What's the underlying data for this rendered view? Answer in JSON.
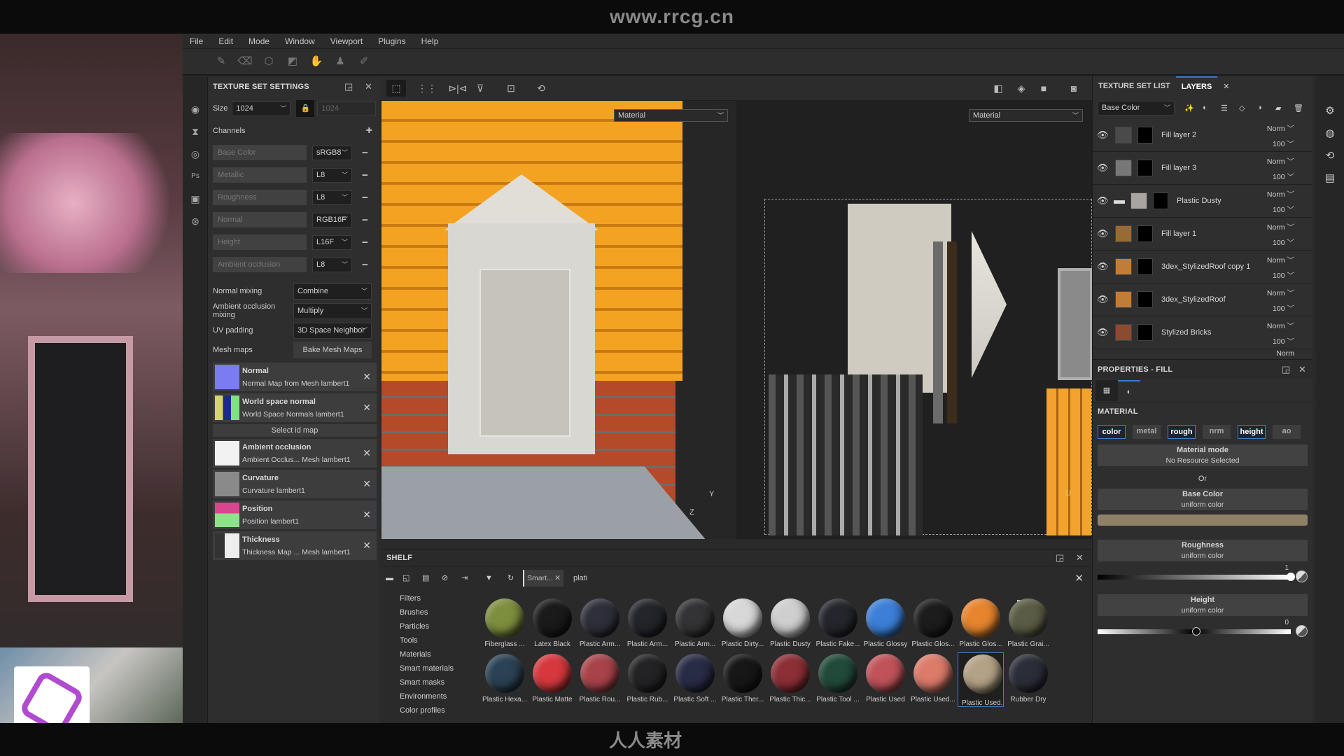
{
  "watermark": {
    "top": "www.rrcg.cn",
    "bottom": "人人素材"
  },
  "menu": [
    "File",
    "Edit",
    "Mode",
    "Window",
    "Viewport",
    "Plugins",
    "Help"
  ],
  "tools": [
    "paint-brush",
    "eraser",
    "projection",
    "polygon-fill",
    "smudge",
    "clone-stamp",
    "color-picker"
  ],
  "texture_set_settings": {
    "title": "TEXTURE SET SETTINGS",
    "size_label": "Size",
    "size_value": "1024",
    "size_locked_value": "1024",
    "channels_label": "Channels",
    "channels": [
      {
        "name": "Base Color",
        "format": "sRGB8"
      },
      {
        "name": "Metallic",
        "format": "L8"
      },
      {
        "name": "Roughness",
        "format": "L8"
      },
      {
        "name": "Normal",
        "format": "RGB16F"
      },
      {
        "name": "Height",
        "format": "L16F"
      },
      {
        "name": "Ambient occlusion",
        "format": "L8"
      }
    ],
    "normal_mixing_label": "Normal mixing",
    "normal_mixing": "Combine",
    "ao_mixing_label": "Ambient occlusion mixing",
    "ao_mixing": "Multiply",
    "uv_padding_label": "UV padding",
    "uv_padding": "3D Space Neighbor",
    "mesh_maps_label": "Mesh maps",
    "bake_button": "Bake Mesh Maps",
    "select_id_map": "Select id map",
    "mesh_maps": [
      {
        "title": "Normal",
        "source": "Normal Map from Mesh lambert1",
        "color": "#7b7bf2"
      },
      {
        "title": "World space normal",
        "source": "World Space Normals lambert1",
        "color": "#e46a6a"
      },
      {
        "title": "Ambient occlusion",
        "source": "Ambient Occlus... Mesh lambert1",
        "color": "#f2f2f2"
      },
      {
        "title": "Curvature",
        "source": "Curvature lambert1",
        "color": "#8a8a8a"
      },
      {
        "title": "Position",
        "source": "Position lambert1",
        "color": "#d9468f"
      },
      {
        "title": "Thickness",
        "source": "Thickness Map ... Mesh lambert1",
        "color": "#444444"
      }
    ]
  },
  "viewport": {
    "view3d_channel": "Material",
    "view2d_channel": "Material",
    "axes": {
      "y": "Y",
      "z": "Z",
      "u": "U"
    }
  },
  "layers_panel": {
    "tab_texture_set_list": "TEXTURE SET LIST",
    "tab_layers": "LAYERS",
    "channel_select": "Base Color",
    "layers": [
      {
        "name": "Fill layer 2",
        "blend": "Norm",
        "opacity": "100",
        "color": "#4a4a4a",
        "folder": false
      },
      {
        "name": "Fill layer 3",
        "blend": "Norm",
        "opacity": "100",
        "color": "#777777",
        "folder": false
      },
      {
        "name": "Plastic Dusty",
        "blend": "Norm",
        "opacity": "100",
        "color": "#a9a6a2",
        "folder": true
      },
      {
        "name": "Fill layer 1",
        "blend": "Norm",
        "opacity": "100",
        "color": "#9a6a35",
        "folder": false
      },
      {
        "name": "3dex_StylizedRoof copy 1",
        "blend": "Norm",
        "opacity": "100",
        "color": "#c07d3a",
        "folder": false
      },
      {
        "name": "3dex_StylizedRoof",
        "blend": "Norm",
        "opacity": "100",
        "color": "#c07d3a",
        "folder": false
      },
      {
        "name": "Stylized Bricks",
        "blend": "Norm",
        "opacity": "100",
        "color": "#8c4a2e",
        "folder": false
      }
    ],
    "partial_blend": "Norm"
  },
  "properties": {
    "title": "PROPERTIES - FILL",
    "section": "MATERIAL",
    "channels": [
      {
        "label": "color",
        "active": true
      },
      {
        "label": "metal",
        "active": false
      },
      {
        "label": "rough",
        "active": true
      },
      {
        "label": "nrm",
        "active": false
      },
      {
        "label": "height",
        "active": true
      },
      {
        "label": "ao",
        "active": false
      }
    ],
    "material_mode": "Material mode",
    "material_mode_sub": "No Resource Selected",
    "or": "Or",
    "base_color": {
      "title": "Base Color",
      "sub": "uniform color",
      "swatch": "#8f8068"
    },
    "roughness": {
      "title": "Roughness",
      "sub": "uniform color",
      "value": "1",
      "fraction": 1.0
    },
    "height": {
      "title": "Height",
      "sub": "uniform color",
      "value": "0",
      "fraction": 0.5
    }
  },
  "shelf": {
    "title": "SHELF",
    "filter_tag": "Smart...",
    "search_value": "plati",
    "categories": [
      "Filters",
      "Brushes",
      "Particles",
      "Tools",
      "Materials",
      "Smart materials",
      "Smart masks",
      "Environments",
      "Color profiles"
    ],
    "materials": [
      {
        "name": "Fiberglass ...",
        "color": "#7d8f3f"
      },
      {
        "name": "Latex Black",
        "color": "#1a1a1a"
      },
      {
        "name": "Plastic Arm...",
        "color": "#2f2f3a"
      },
      {
        "name": "Plastic Arm...",
        "color": "#24252b"
      },
      {
        "name": "Plastic Arm...",
        "color": "#333335"
      },
      {
        "name": "Plastic Dirty...",
        "color": "#d8d8d8"
      },
      {
        "name": "Plastic Dusty",
        "color": "#cfcfcf"
      },
      {
        "name": "Plastic Fake...",
        "color": "#25262d"
      },
      {
        "name": "Plastic Glossy",
        "color": "#3b7fd8"
      },
      {
        "name": "Plastic Glos...",
        "color": "#1c1c1c"
      },
      {
        "name": "Plastic Glos...",
        "color": "#e7852e"
      },
      {
        "name": "Plastic Grai...",
        "color": "#5b5c45"
      },
      {
        "name": "Plastic Hexa...",
        "color": "#2b4254"
      },
      {
        "name": "Plastic Matte",
        "color": "#d6383e"
      },
      {
        "name": "Plastic Rou...",
        "color": "#a9434a"
      },
      {
        "name": "Plastic Rub...",
        "color": "#232325"
      },
      {
        "name": "Plastic Soft ...",
        "color": "#282c46"
      },
      {
        "name": "Plastic Ther...",
        "color": "#171717"
      },
      {
        "name": "Plastic Thic...",
        "color": "#8c2f36"
      },
      {
        "name": "Plastic Tool ...",
        "color": "#214a3a"
      },
      {
        "name": "Plastic Used",
        "color": "#c0535a"
      },
      {
        "name": "Plastic Used...",
        "color": "#dc7b6a"
      },
      {
        "name": "Plastic Used...",
        "color": "#b4a286",
        "selected": true
      },
      {
        "name": "Rubber Dry",
        "color": "#2b2e38"
      }
    ]
  }
}
